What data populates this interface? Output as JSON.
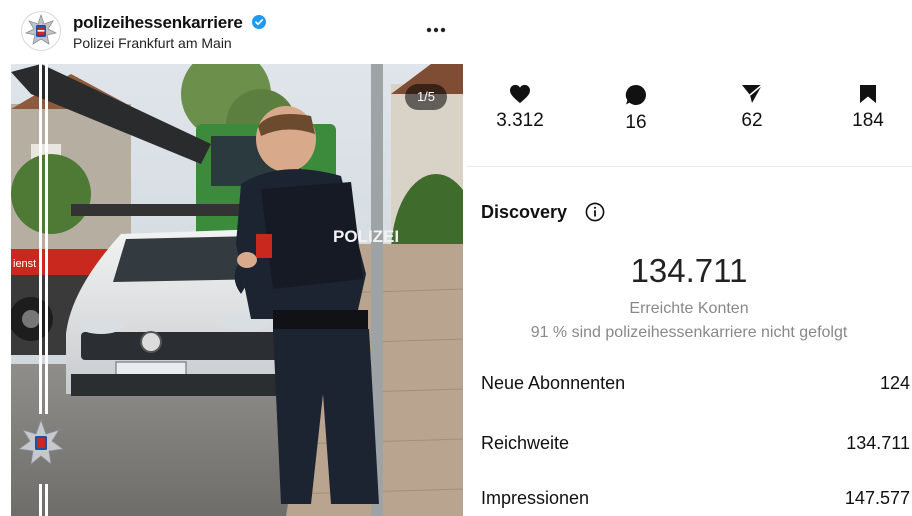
{
  "post": {
    "username": "polizeihessenkarriere",
    "location": "Polizei Frankfurt am Main",
    "counter": "1/5",
    "vest_text": "POLIZEI",
    "truck_text": "ienst"
  },
  "stats": {
    "likes": "3.312",
    "comments": "16",
    "shares": "62",
    "saves": "184"
  },
  "discovery": {
    "title": "Discovery",
    "reached": "134.711",
    "reached_label": "Erreichte Konten",
    "not_following": "91 % sind polizeihessenkarriere nicht gefolgt",
    "rows": [
      {
        "label": "Neue Abonnenten",
        "value": "124"
      },
      {
        "label": "Reichweite",
        "value": "134.711"
      },
      {
        "label": "Impressionen",
        "value": "147.577"
      }
    ]
  },
  "colors": {
    "verified": "#1d9bf0",
    "police_blue": "#1c2331",
    "truck_green": "#3c8a3c",
    "truck_red": "#c8281e"
  },
  "icons": [
    "verified-badge-icon",
    "more-options-icon",
    "heart-icon",
    "comment-icon",
    "share-icon",
    "bookmark-icon",
    "info-icon",
    "police-star-icon"
  ]
}
